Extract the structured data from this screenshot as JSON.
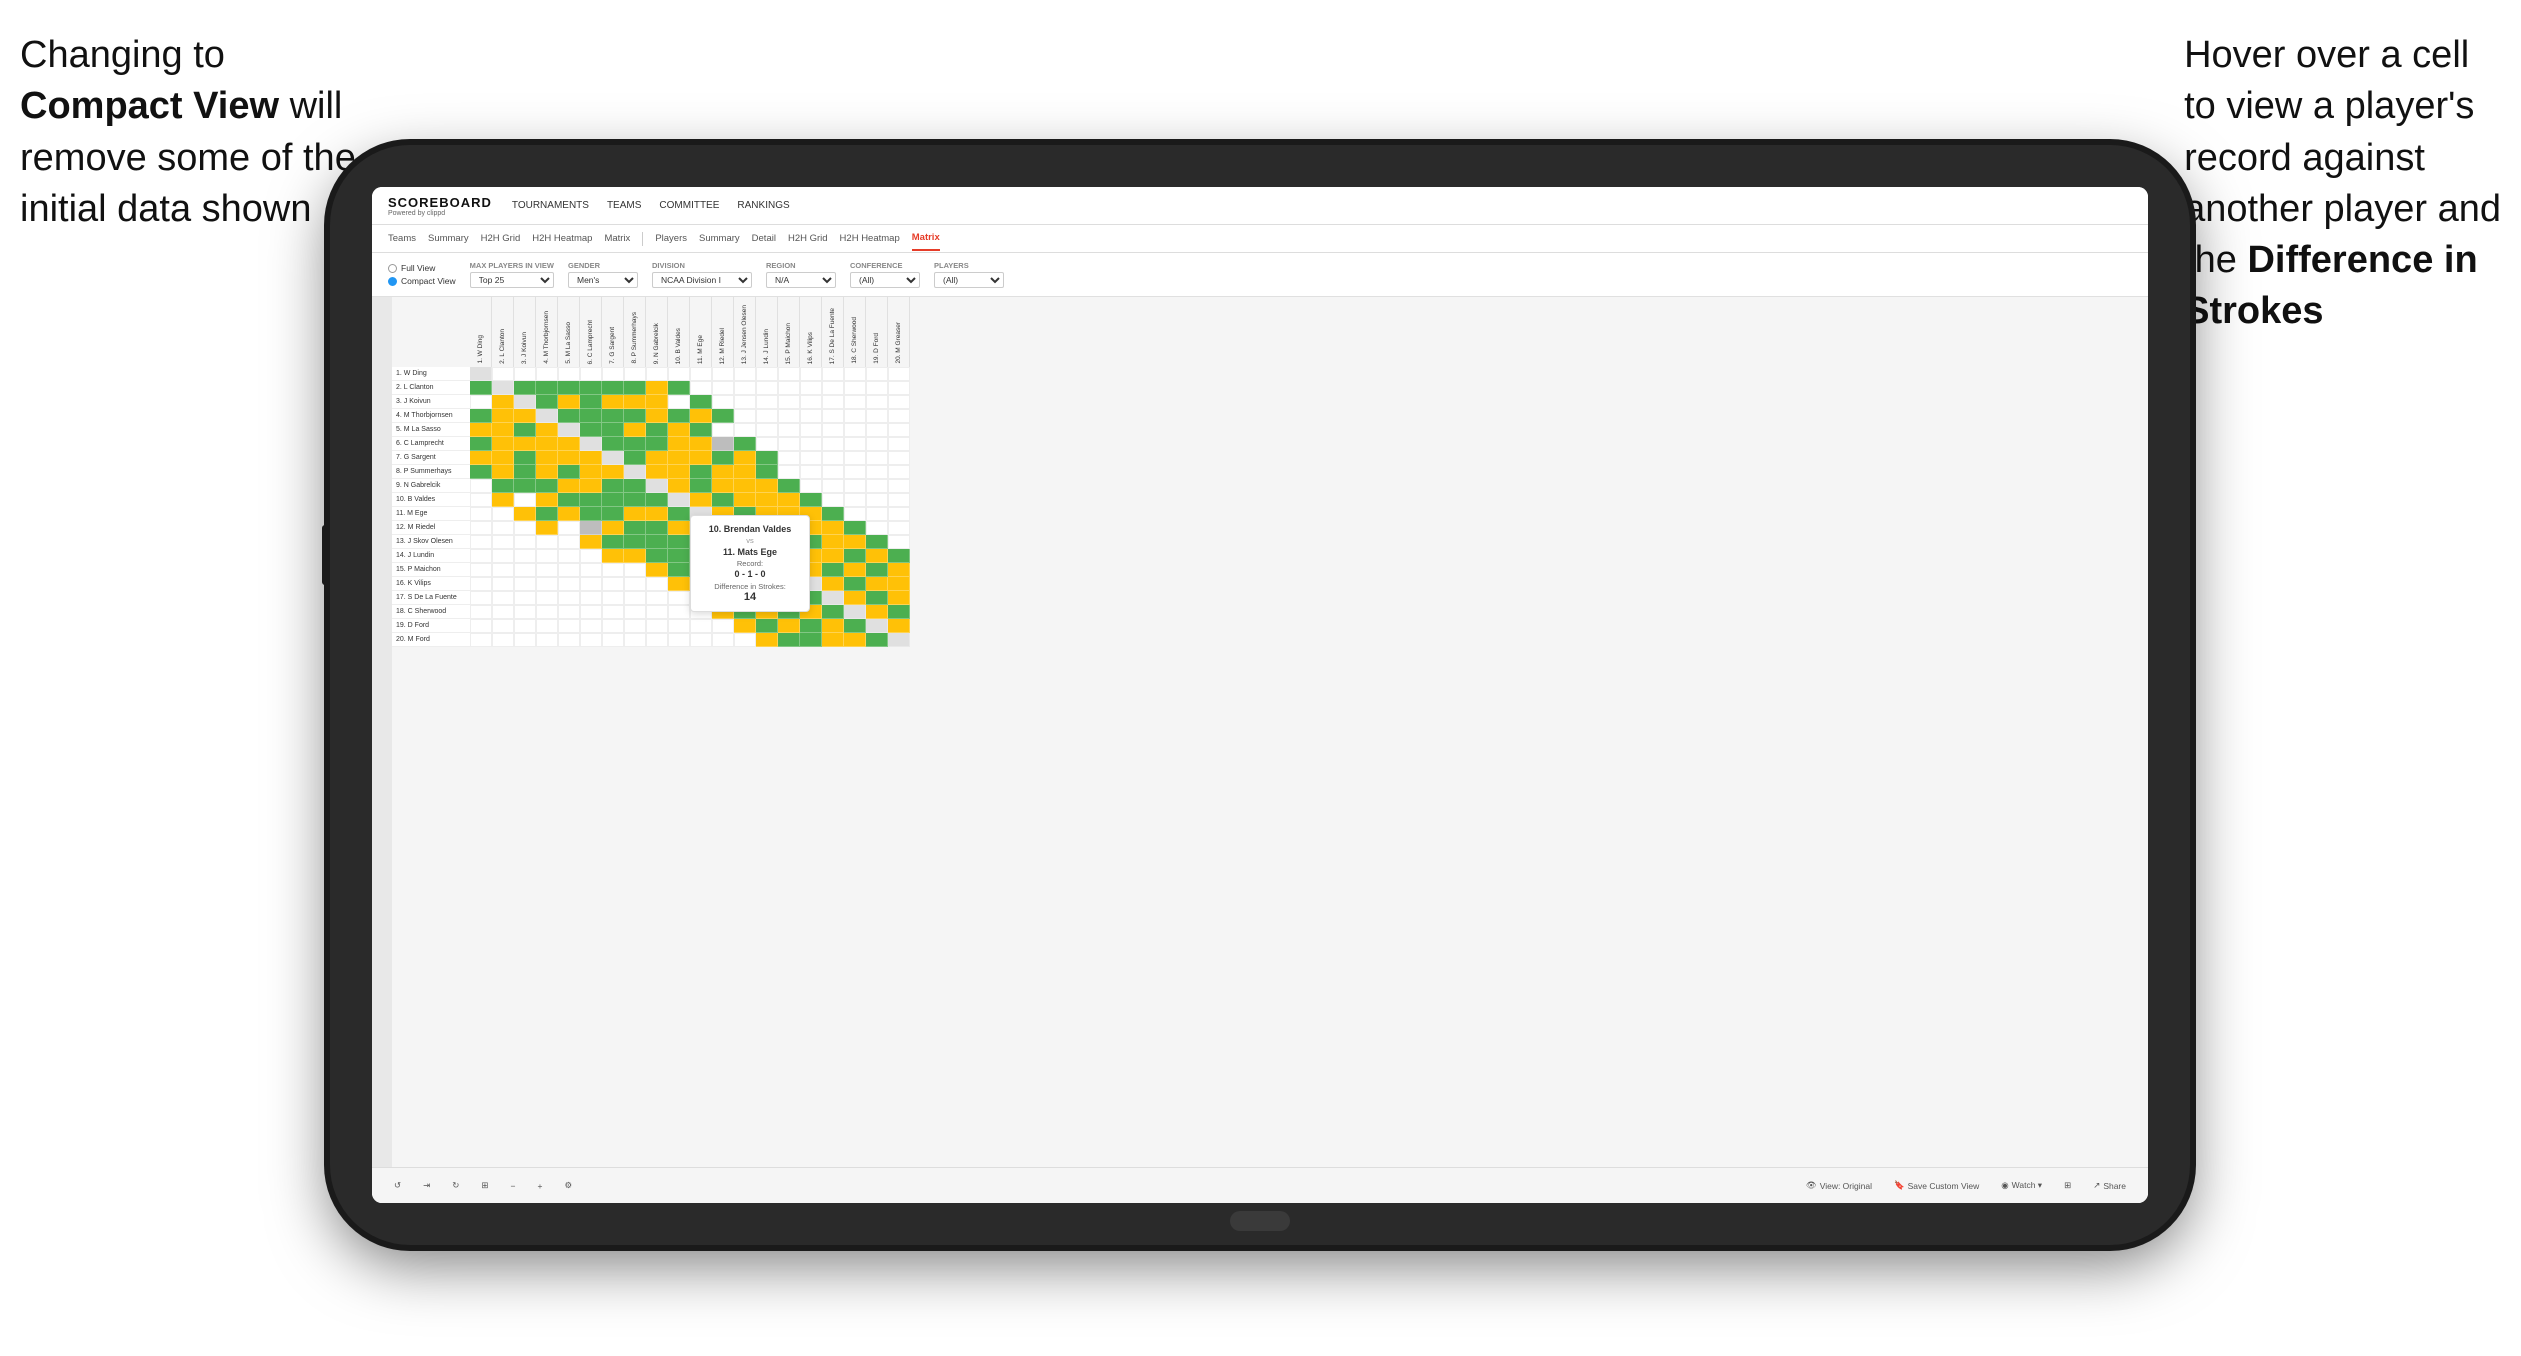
{
  "annotation_left": {
    "line1": "Changing to",
    "line2_bold": "Compact View",
    "line2_rest": " will",
    "line3": "remove some of the",
    "line4": "initial data shown"
  },
  "annotation_right": {
    "line1": "Hover over a cell",
    "line2": "to view a player's",
    "line3": "record against",
    "line4": "another player and",
    "line5_prefix": "the ",
    "line5_bold": "Difference in",
    "line6_bold": "Strokes"
  },
  "nav": {
    "logo_title": "SCOREBOARD",
    "logo_sub": "Powered by clippd",
    "items": [
      "TOURNAMENTS",
      "TEAMS",
      "COMMITTEE",
      "RANKINGS"
    ]
  },
  "sub_nav_left": [
    "Teams",
    "Summary",
    "H2H Grid",
    "H2H Heatmap",
    "Matrix"
  ],
  "sub_nav_right": [
    "Players",
    "Summary",
    "Detail",
    "H2H Grid",
    "H2H Heatmap",
    "Matrix"
  ],
  "sub_nav_active": "Matrix",
  "filters": {
    "view_full": "Full View",
    "view_compact": "Compact View",
    "max_players_label": "Max players in view",
    "max_players_value": "Top 25",
    "gender_label": "Gender",
    "gender_value": "Men's",
    "division_label": "Division",
    "division_value": "NCAA Division I",
    "region_label": "Region",
    "region_value": "N/A",
    "conference_label": "Conference",
    "conference_value": "(All)",
    "players_label": "Players",
    "players_value": "(All)"
  },
  "players": [
    "1. W Ding",
    "2. L Clanton",
    "3. J Koivun",
    "4. M Thorbjornsen",
    "5. M La Sasso",
    "6. C Lamprecht",
    "7. G Sargent",
    "8. P Summerhays",
    "9. N Gabrelcik",
    "10. B Valdes",
    "11. M Ege",
    "12. M Riedel",
    "13. J Skov Olesen",
    "14. J Lundin",
    "15. P Maichon",
    "16. K Vilips",
    "17. S De La Fuente",
    "18. C Sherwood",
    "19. D Ford",
    "20. M Ford"
  ],
  "col_headers": [
    "1. W Ding",
    "2. L Clanton",
    "3. J Koivun",
    "4. M Thorbjornsen",
    "5. M La Sasso",
    "6. C Lamprecht",
    "7. G Sargent",
    "8. P Summerhays",
    "9. N Gabrelcik",
    "10. B Valdes",
    "11. M Ege",
    "12. M Riedel",
    "13. J Jensen Olesen",
    "14. J Lundin",
    "15. P Maichon",
    "16. K Vilips",
    "17. S De La Fuente",
    "18. C Sherwood",
    "19. D Ford",
    "20. M Greaser"
  ],
  "tooltip": {
    "player1": "10. Brendan Valdes",
    "vs": "vs",
    "player2": "11. Mats Ege",
    "record_label": "Record:",
    "record": "0 - 1 - 0",
    "diff_label": "Difference in Strokes:",
    "diff": "14"
  },
  "toolbar": {
    "undo": "↺",
    "redo": "↻",
    "view_original": "View: Original",
    "save_custom": "Save Custom View",
    "watch": "Watch ▾",
    "share": "Share"
  }
}
